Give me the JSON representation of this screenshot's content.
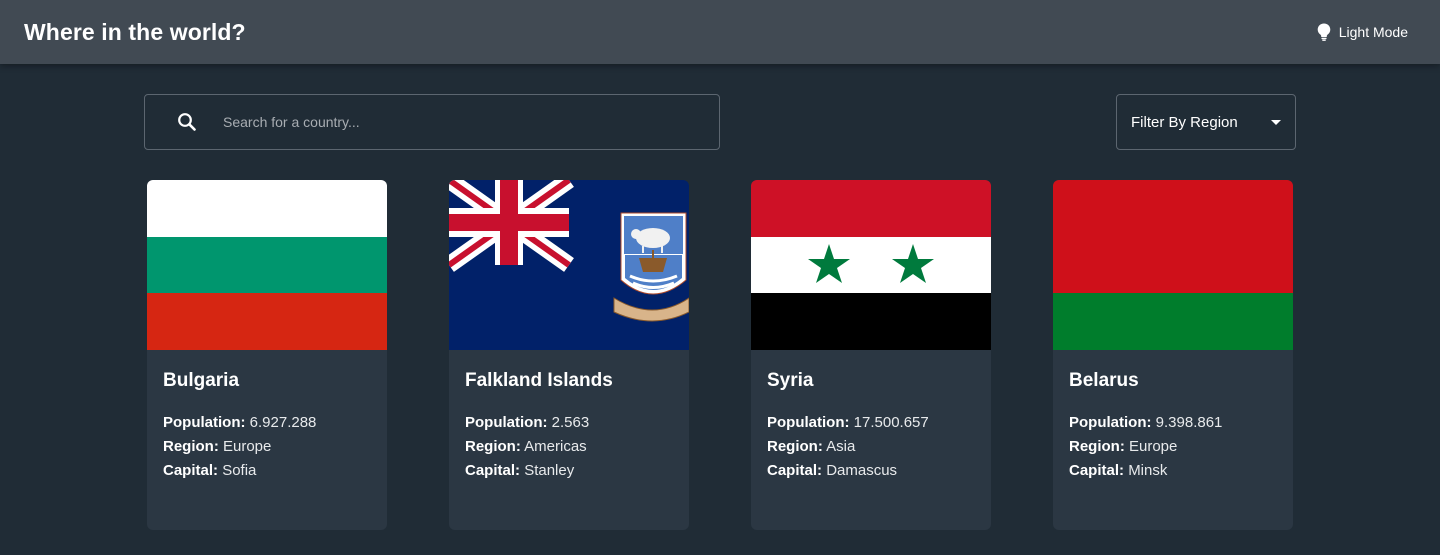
{
  "header": {
    "title": "Where in the world?",
    "mode_label": "Light Mode",
    "mode_icon": "lightbulb-icon"
  },
  "search": {
    "placeholder": "Search for a country...",
    "value": "",
    "icon": "search-icon"
  },
  "filter": {
    "label": "Filter By Region",
    "icon": "chevron-down-icon"
  },
  "labels": {
    "population": "Population:",
    "region": "Region:",
    "capital": "Capital:"
  },
  "countries": [
    {
      "name": "Bulgaria",
      "population": "6.927.288",
      "region": "Europe",
      "capital": "Sofia",
      "flag": "bulgaria-flag",
      "colors": [
        "#ffffff",
        "#00966e",
        "#d62612"
      ]
    },
    {
      "name": "Falkland Islands",
      "population": "2.563",
      "region": "Americas",
      "capital": "Stanley",
      "flag": "falkland-islands-flag",
      "colors": [
        "#012169",
        "#ffffff",
        "#c8102e"
      ]
    },
    {
      "name": "Syria",
      "population": "17.500.657",
      "region": "Asia",
      "capital": "Damascus",
      "flag": "syria-flag",
      "colors": [
        "#ce1126",
        "#ffffff",
        "#000000",
        "#007a3d"
      ]
    },
    {
      "name": "Belarus",
      "population": "9.398.861",
      "region": "Europe",
      "capital": "Minsk",
      "flag": "belarus-flag",
      "colors": [
        "#cf101a",
        "#007d2c"
      ]
    }
  ],
  "theme": {
    "background": "#202c36",
    "elements": "#2b3743",
    "header": "#414a53",
    "text": "#ffffff"
  }
}
